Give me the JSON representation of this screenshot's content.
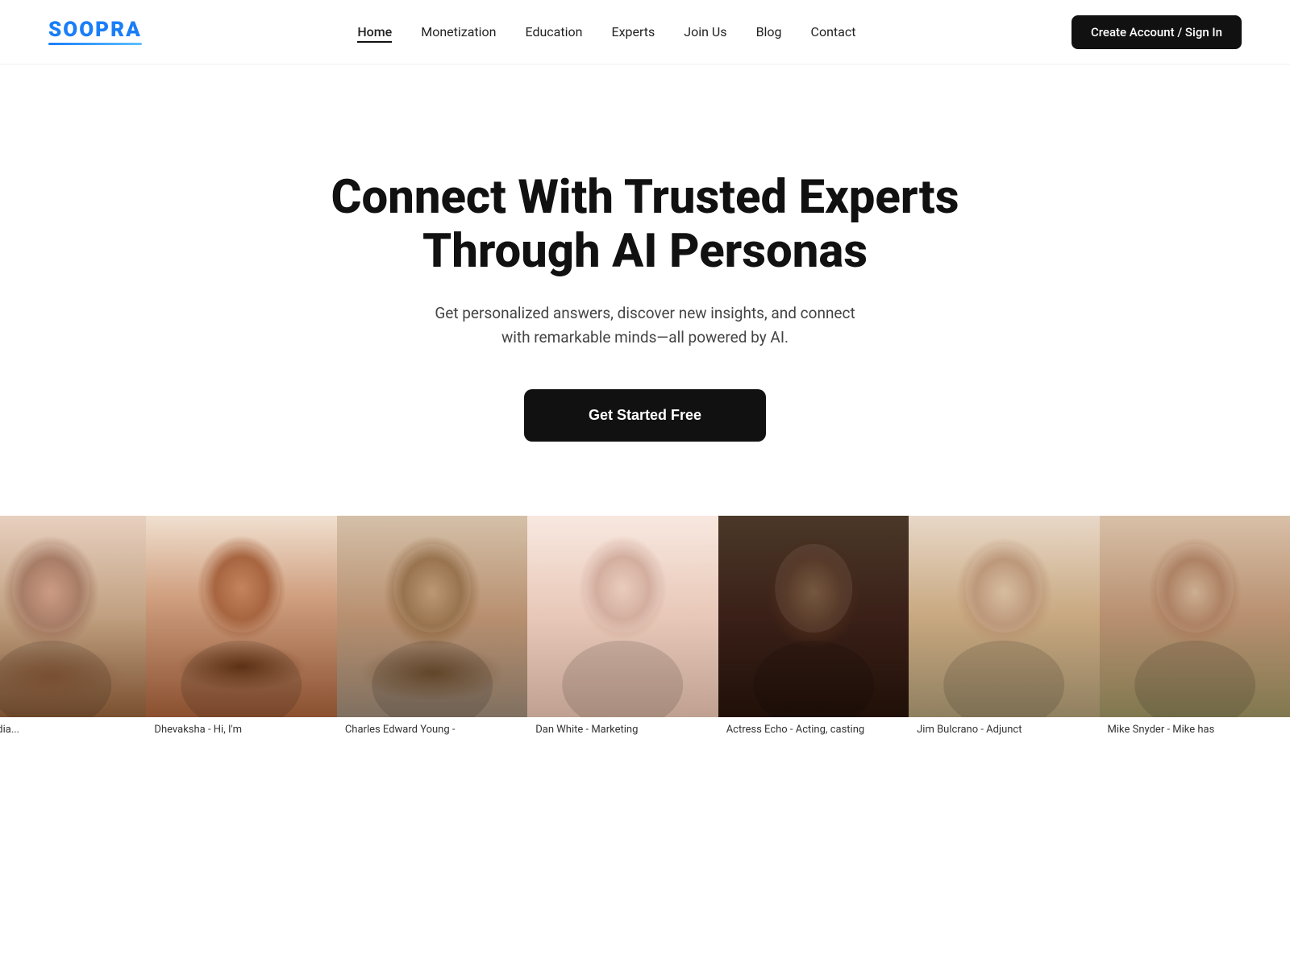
{
  "brand": {
    "name": "SOOPRA",
    "tagline": "SOOPRA"
  },
  "nav": {
    "links": [
      {
        "label": "Home",
        "href": "#",
        "active": true
      },
      {
        "label": "Monetization",
        "href": "#",
        "active": false
      },
      {
        "label": "Education",
        "href": "#",
        "active": false
      },
      {
        "label": "Experts",
        "href": "#",
        "active": false
      },
      {
        "label": "Join Us",
        "href": "#",
        "active": false
      },
      {
        "label": "Blog",
        "href": "#",
        "active": false
      },
      {
        "label": "Contact",
        "href": "#",
        "active": false
      }
    ],
    "cta_label": "Create Account / Sign In"
  },
  "hero": {
    "title": "Connect With Trusted Experts Through AI Personas",
    "subtitle": "Get personalized answers, discover new insights, and connect with remarkable minds—all powered by AI.",
    "cta_label": "Get Started Free"
  },
  "experts": [
    {
      "id": 1,
      "caption": "ey - Media...",
      "gradient_class": "ep1"
    },
    {
      "id": 2,
      "caption": "Dhevaksha - Hi, I'm",
      "gradient_class": "ep2"
    },
    {
      "id": 3,
      "caption": "Charles Edward Young -",
      "gradient_class": "ep3"
    },
    {
      "id": 4,
      "caption": "Dan White - Marketing",
      "gradient_class": "ep4"
    },
    {
      "id": 5,
      "caption": "Actress Echo - Acting, casting",
      "gradient_class": "ep5"
    },
    {
      "id": 6,
      "caption": "Jim Bulcrano - Adjunct",
      "gradient_class": "ep6"
    },
    {
      "id": 7,
      "caption": "Mike Snyder - Mike has",
      "gradient_class": "ep7"
    }
  ]
}
